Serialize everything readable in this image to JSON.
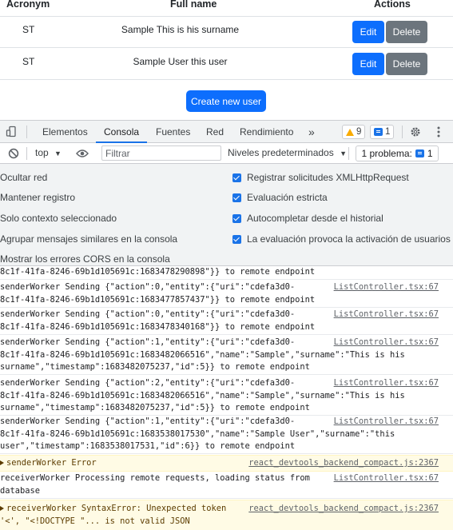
{
  "table": {
    "headers": {
      "acronym": "Acronym",
      "full_name": "Full name",
      "actions": "Actions"
    },
    "rows": [
      {
        "acronym": "ST",
        "full_name": "Sample This is his surname",
        "edit": "Edit",
        "delete": "Delete"
      },
      {
        "acronym": "ST",
        "full_name": "Sample User this user",
        "edit": "Edit",
        "delete": "Delete"
      }
    ],
    "create_button": "Create new user"
  },
  "devtools": {
    "tabs": [
      "Elementos",
      "Consola",
      "Fuentes",
      "Red",
      "Rendimiento"
    ],
    "active_tab": "Consola",
    "more_tabs": "»",
    "warning_count": "9",
    "message_count": "1",
    "toolbar": {
      "context": "top",
      "filter_placeholder": "Filtrar",
      "levels": "Niveles predeterminados",
      "problems": "1 problema:",
      "problems_count": "1"
    },
    "settings": {
      "left": [
        "Ocultar red",
        "Mantener registro",
        "Solo contexto seleccionado",
        "Agrupar mensajes similares en la consola",
        "Mostrar los errores CORS en la consola"
      ],
      "right": [
        "Registrar solicitudes XMLHttpRequest",
        "Evaluación estricta",
        "Autocompletar desde el historial",
        "La evaluación provoca la activación de usuarios"
      ]
    },
    "console_messages": [
      {
        "lines": [
          "8c1f-41fa-8246-69b1d105691c:1683478290898\"}} to remote endpoint"
        ],
        "source": "",
        "level": "info"
      },
      {
        "lines": [
          "senderWorker Sending {\"action\":0,\"entity\":{\"uri\":\"cdefa3d0-",
          "8c1f-41fa-8246-69b1d105691c:1683477857437\"}} to remote endpoint"
        ],
        "source": "ListController.tsx:67",
        "level": "info"
      },
      {
        "lines": [
          "senderWorker Sending {\"action\":0,\"entity\":{\"uri\":\"cdefa3d0-",
          "8c1f-41fa-8246-69b1d105691c:1683478340168\"}} to remote endpoint"
        ],
        "source": "ListController.tsx:67",
        "level": "info"
      },
      {
        "lines": [
          "senderWorker Sending {\"action\":1,\"entity\":{\"uri\":\"cdefa3d0-",
          "8c1f-41fa-8246-69b1d105691c:1683482066516\",\"name\":\"Sample\",\"surname\":\"This is his",
          "surname\",\"timestamp\":1683482075237,\"id\":5}} to remote endpoint"
        ],
        "source": "ListController.tsx:67",
        "level": "info"
      },
      {
        "lines": [
          "senderWorker Sending {\"action\":2,\"entity\":{\"uri\":\"cdefa3d0-",
          "8c1f-41fa-8246-69b1d105691c:1683482066516\",\"name\":\"Sample\",\"surname\":\"This is his",
          "surname\",\"timestamp\":1683482075237,\"id\":5}} to remote endpoint"
        ],
        "source": "ListController.tsx:67",
        "level": "info"
      },
      {
        "lines": [
          "senderWorker Sending {\"action\":1,\"entity\":{\"uri\":\"cdefa3d0-",
          "8c1f-41fa-8246-69b1d105691c:1683538017530\",\"name\":\"Sample User\",\"surname\":\"this",
          "user\",\"timestamp\":1683538017531,\"id\":6}} to remote endpoint"
        ],
        "source": "ListController.tsx:67",
        "level": "info"
      },
      {
        "lines": [
          "senderWorker Error"
        ],
        "source": "react_devtools_backend_compact.js:2367",
        "level": "warn"
      },
      {
        "lines": [
          "receiverWorker Processing remote requests, loading status from",
          "database"
        ],
        "source": "ListController.tsx:67",
        "level": "info"
      },
      {
        "lines": [
          "receiverWorker SyntaxError: Unexpected token",
          "'<', \"<!DOCTYPE \"... is not valid JSON"
        ],
        "source": "react_devtools_backend_compact.js:2367",
        "level": "warn"
      }
    ]
  },
  "colors": {
    "primary": "#0d6efd",
    "secondary": "#6c757d",
    "devtools_accent": "#1a73e8",
    "warning": "#f9ab00",
    "warning_bg": "#fffbe5"
  }
}
